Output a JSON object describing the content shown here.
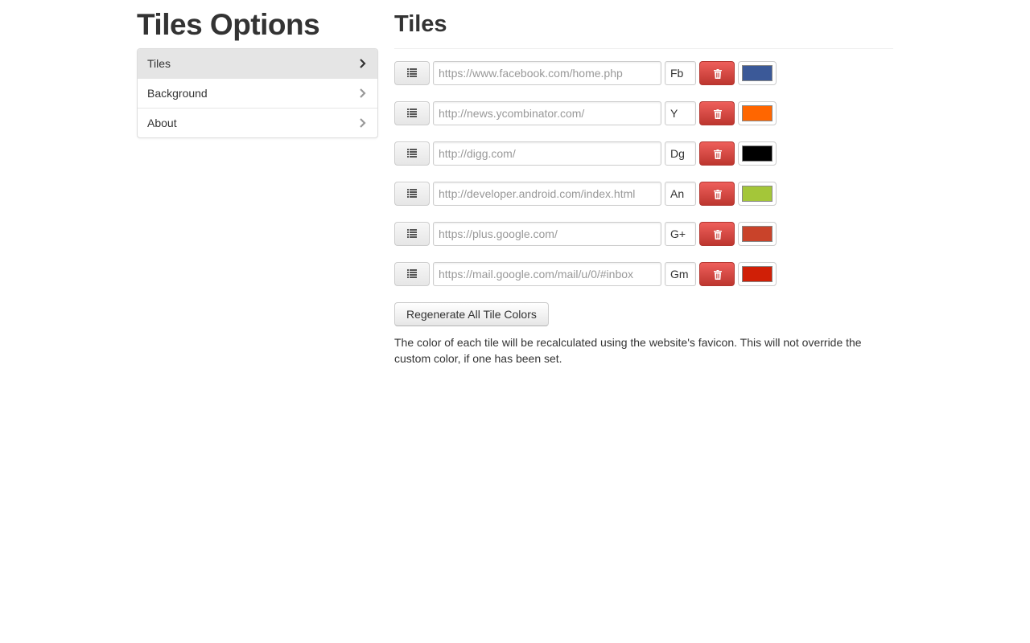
{
  "page": {
    "title": "Tiles Options"
  },
  "sidebar": {
    "items": [
      {
        "label": "Tiles",
        "active": true
      },
      {
        "label": "Background",
        "active": false
      },
      {
        "label": "About",
        "active": false
      }
    ]
  },
  "main": {
    "section_title": "Tiles",
    "tiles": [
      {
        "url_placeholder": "https://www.facebook.com/home.php",
        "abbr": "Fb",
        "color": "#3b5998"
      },
      {
        "url_placeholder": "http://news.ycombinator.com/",
        "abbr": "Y",
        "color": "#ff6600"
      },
      {
        "url_placeholder": "http://digg.com/",
        "abbr": "Dg",
        "color": "#000000"
      },
      {
        "url_placeholder": "http://developer.android.com/index.html",
        "abbr": "An",
        "color": "#a4c639"
      },
      {
        "url_placeholder": "https://plus.google.com/",
        "abbr": "G+",
        "color": "#c9432a"
      },
      {
        "url_placeholder": "https://mail.google.com/mail/u/0/#inbox",
        "abbr": "Gm",
        "color": "#d01f06"
      }
    ],
    "regenerate_label": "Regenerate All Tile Colors",
    "help_text": "The color of each tile will be recalculated using the website's favicon. This will not override the custom color, if one has been set."
  },
  "icons": {
    "handle": "list-icon",
    "delete": "trash-icon",
    "nav_arrow": "chevron-right-icon"
  },
  "colors": {
    "danger": "#da4f49",
    "nav_active_bg": "#e5e5e5"
  }
}
